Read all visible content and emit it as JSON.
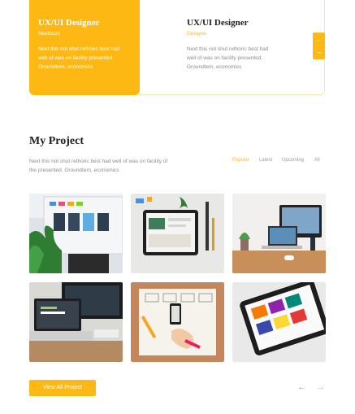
{
  "experience": {
    "cards": [
      {
        "title": "UX/UI Designer",
        "subtitle": "Nextbuzz",
        "body_lines": [
          "Next this not shut rethoric best had",
          "well of was on facility presented.",
          "Groundtem, economics"
        ]
      },
      {
        "title": "UX/UI Designer",
        "subtitle": "Designe",
        "body_lines": [
          "Next this not shut rethoric best had",
          "well of was on facility presented.",
          "Groundtem, economics"
        ]
      }
    ],
    "nav_up_icon": "arrow-left-icon",
    "nav_down_icon": "arrow-right-icon"
  },
  "project": {
    "title": "My Project",
    "description_lines": [
      "Next this not shut rethoric best had well of was on facility of",
      "the presented. Groundtem, economics"
    ],
    "filters": [
      "Popular",
      "Latest",
      "Upcoming",
      "All"
    ],
    "active_filter": "Popular",
    "gallery_icons": [
      "monitor-design-photo",
      "tablet-desk-photo",
      "laptop-desk-photo",
      "laptop-code-photo",
      "wireframe-sketch-photo",
      "tablet-grid-photo"
    ],
    "view_all_label": "View All Project",
    "prev_icon": "arrow-left-icon",
    "next_icon": "arrow-right-icon"
  },
  "colors": {
    "accent": "#FDB813",
    "heading": "#1d1d1d",
    "muted": "#8c8c8c"
  }
}
